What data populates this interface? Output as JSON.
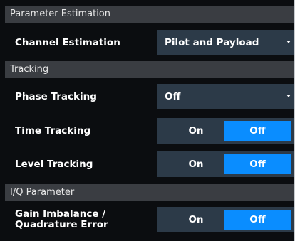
{
  "sections": {
    "parameter_estimation": {
      "title": "Parameter Estimation"
    },
    "tracking": {
      "title": "Tracking"
    },
    "iq_parameter": {
      "title": "I/Q Parameter"
    }
  },
  "channel_estimation": {
    "label": "Channel Estimation",
    "value": "Pilot and Payload"
  },
  "phase_tracking": {
    "label": "Phase Tracking",
    "value": "Off"
  },
  "time_tracking": {
    "label": "Time Tracking",
    "on_label": "On",
    "off_label": "Off",
    "selected": "Off"
  },
  "level_tracking": {
    "label": "Level Tracking",
    "on_label": "On",
    "off_label": "Off",
    "selected": "Off"
  },
  "gain_imbalance": {
    "label_line1": "Gain Imbalance /",
    "label_line2": "Quadrature Error",
    "on_label": "On",
    "off_label": "Off",
    "selected": "Off"
  },
  "colors": {
    "panel_bg": "#0b0d10",
    "header_bg": "#3a3d42",
    "control_bg": "#2c3a48",
    "accent": "#0a8dff"
  }
}
